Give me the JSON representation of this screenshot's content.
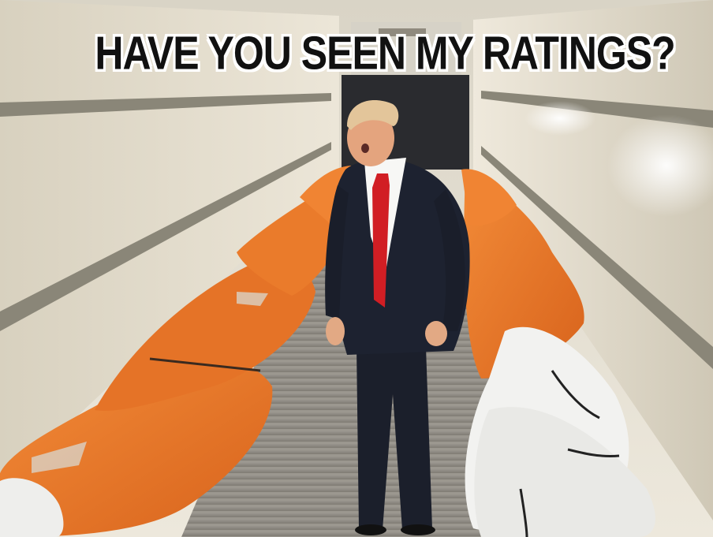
{
  "meme": {
    "caption": "HAVE YOU SEEN MY RATINGS?"
  },
  "colors": {
    "wall": "#e8e2d4",
    "floor": "#8f8c86",
    "orange_bag": "#e8782a",
    "white_bag": "#f2f2f0",
    "suit": "#1b1f2b",
    "tie": "#d11e24"
  }
}
